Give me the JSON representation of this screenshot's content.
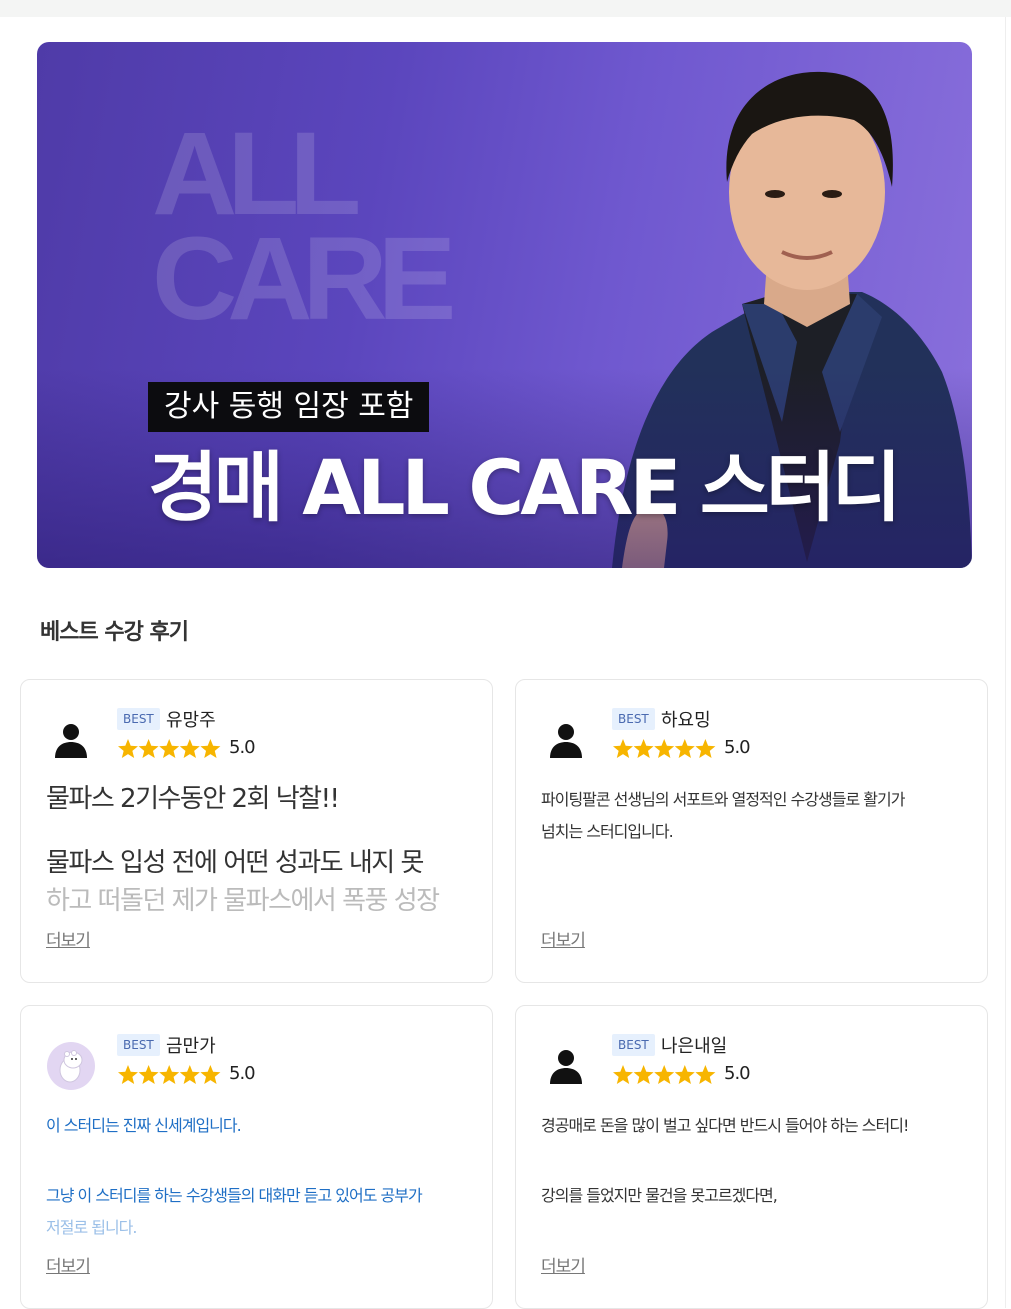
{
  "hero": {
    "watermark_line1": "ALL",
    "watermark_line2": "CARE",
    "tag": "강사 동행 임장 포함",
    "title": "경매 ALL CARE 스터디"
  },
  "section_title": "베스트 수강 후기",
  "reviews": [
    {
      "badge": "BEST",
      "name": "유망주",
      "rating": 5,
      "score": "5.0",
      "avatar_icon": "person-silhouette-icon",
      "lines": [
        "물파스 2기수동안 2회 낙찰!!",
        "물파스 입성 전에 어떤 성과도 내지 못",
        "하고 떠돌던 제가 물파스에서 폭풍 성장"
      ],
      "more": "더보기"
    },
    {
      "badge": "BEST",
      "name": "하요밍",
      "rating": 5,
      "score": "5.0",
      "avatar_icon": "person-silhouette-icon",
      "lines": [
        "파이팅팔콘 선생님의 서포트와 열정적인 수강생들로 활기가",
        "넘치는 스터디입니다."
      ],
      "more": "더보기"
    },
    {
      "badge": "BEST",
      "name": "금만가",
      "rating": 5,
      "score": "5.0",
      "avatar_icon": "moomin-avatar-icon",
      "lines": [
        "이 스터디는 진짜 신세계입니다.",
        "그냥 이 스터디를 하는 수강생들의 대화만 듣고 있어도 공부가",
        "저절로 됩니다."
      ],
      "more": "더보기"
    },
    {
      "badge": "BEST",
      "name": "나은내일",
      "rating": 5,
      "score": "5.0",
      "avatar_icon": "person-silhouette-icon",
      "lines": [
        "경공매로 돈을 많이 벌고 싶다면 반드시 들어야 하는 스터디!",
        "강의를 들었지만 물건을 못고르겠다면,"
      ],
      "more": "더보기"
    }
  ],
  "colors": {
    "hero_gradient_start": "#4f3ba8",
    "hero_gradient_end": "#8a70dc",
    "star": "#f7b500",
    "badge_bg": "#e6f0fd",
    "blue_text": "#1f6fc5"
  }
}
